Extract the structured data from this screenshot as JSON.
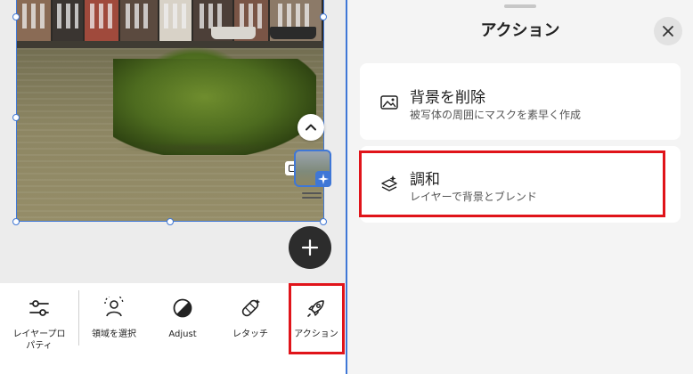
{
  "panel": {
    "title": "アクション",
    "items": [
      {
        "title": "背景を削除",
        "subtitle": "被写体の周囲にマスクを素早く作成",
        "icon": "image-icon"
      },
      {
        "title": "調和",
        "subtitle": "レイヤーで背景とブレンド",
        "icon": "harmonize-sparkle-icon"
      }
    ]
  },
  "toolbar": {
    "items": [
      {
        "label": "レイヤープロ\nパティ",
        "icon": "sliders-icon"
      },
      {
        "label": "領域を選択",
        "icon": "select-subject-icon"
      },
      {
        "label": "Adjust",
        "icon": "adjust-icon"
      },
      {
        "label": "レタッチ",
        "icon": "bandage-icon"
      },
      {
        "label": "アクション",
        "icon": "rocket-icon"
      }
    ]
  },
  "colors": {
    "accent": "#3f77d6",
    "highlight": "#e0141a",
    "fab": "#2c2c2c"
  }
}
